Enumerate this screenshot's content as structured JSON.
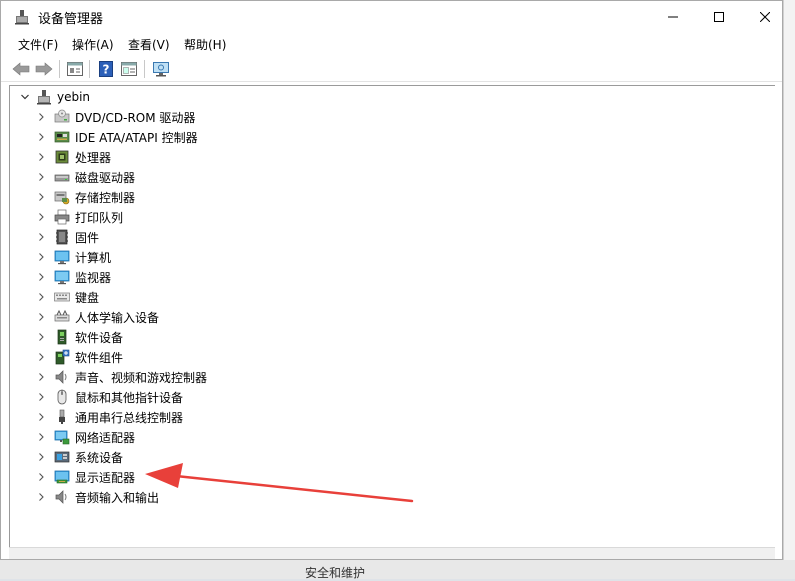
{
  "window": {
    "title": "设备管理器"
  },
  "menu": [
    "文件(F)",
    "操作(A)",
    "查看(V)",
    "帮助(H)"
  ],
  "toolbar": {
    "buttons": [
      "back-icon",
      "forward-icon",
      "properties-icon",
      "help-icon",
      "details-icon",
      "monitor-scan-icon"
    ]
  },
  "tree": {
    "root": "yebin",
    "items": [
      {
        "label": "DVD/CD-ROM 驱动器",
        "icon": "dvd-drive-icon"
      },
      {
        "label": "IDE ATA/ATAPI 控制器",
        "icon": "ide-controller-icon"
      },
      {
        "label": "处理器",
        "icon": "processor-icon"
      },
      {
        "label": "磁盘驱动器",
        "icon": "disk-drive-icon"
      },
      {
        "label": "存储控制器",
        "icon": "storage-controller-icon"
      },
      {
        "label": "打印队列",
        "icon": "printer-icon"
      },
      {
        "label": "固件",
        "icon": "firmware-icon"
      },
      {
        "label": "计算机",
        "icon": "computer-icon"
      },
      {
        "label": "监视器",
        "icon": "monitor-icon"
      },
      {
        "label": "键盘",
        "icon": "keyboard-icon"
      },
      {
        "label": "人体学输入设备",
        "icon": "hid-icon"
      },
      {
        "label": "软件设备",
        "icon": "software-device-icon"
      },
      {
        "label": "软件组件",
        "icon": "software-component-icon"
      },
      {
        "label": "声音、视频和游戏控制器",
        "icon": "speaker-icon"
      },
      {
        "label": "鼠标和其他指针设备",
        "icon": "mouse-icon"
      },
      {
        "label": "通用串行总线控制器",
        "icon": "usb-icon"
      },
      {
        "label": "网络适配器",
        "icon": "network-adapter-icon"
      },
      {
        "label": "系统设备",
        "icon": "system-device-icon"
      },
      {
        "label": "显示适配器",
        "icon": "display-adapter-icon"
      },
      {
        "label": "音频输入和输出",
        "icon": "audio-io-icon"
      }
    ]
  },
  "background": {
    "partial_text": "安全和维护"
  },
  "colors": {
    "annotation_arrow": "#e8403a",
    "monitor_blue": "#3aa0e0"
  }
}
